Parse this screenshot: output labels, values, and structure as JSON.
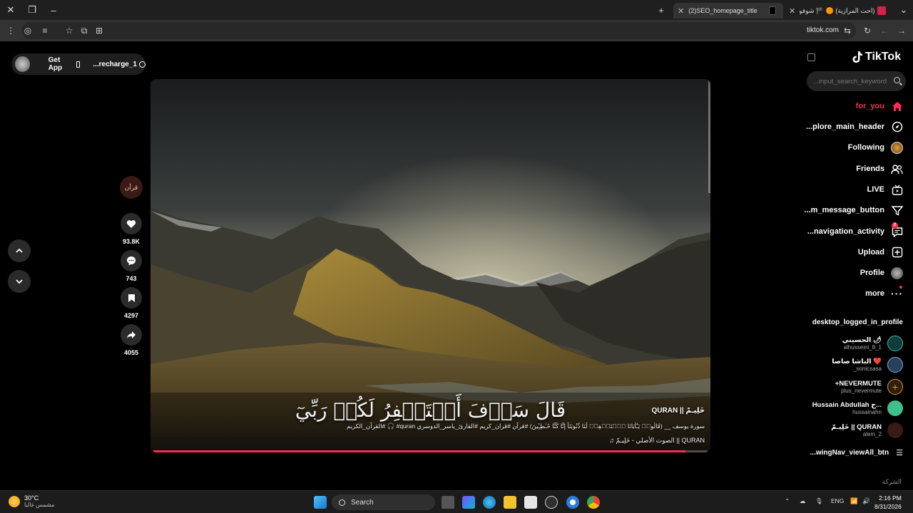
{
  "browser": {
    "tabs": [
      {
        "title": "(2)SEO_homepage_title",
        "active": true
      },
      {
        "title": "(احت المرازية) 🟠 🏴 شوفو حـ",
        "active": false
      }
    ],
    "url": "tiktok.com"
  },
  "top_pill": {
    "get_app_label": "Get App",
    "recharge_label": "...recharge_1"
  },
  "actions": {
    "creator_label": "قرآن",
    "likes": "93.8K",
    "comments": "743",
    "saves": "4297",
    "shares": "4055"
  },
  "video": {
    "verse": "قَالَ سَوۡفَ أَسۡتَغۡفِرُ لَكُمۡ رَبِّيٓ",
    "author": "خَلِيـمّ || QURAN",
    "description": "سورة يوسف __ (قَالُوا۟ يَـٰٓأَبَانَا ٱسۡتَغۡفِرۡ لَنَا ذُنُوبَنَآ إِنَّا كُنَّا خَـٰطِـِٔينَ) #قرآن #قران_كريم #القارئ_ياسر_الدوسري quran# 🎧 #القرآن_الكريم",
    "sound": "QURAN || الصوت الأصلي - خَلِيـمّ",
    "progress": 0.96
  },
  "sidebar": {
    "logo": "TikTok",
    "search_placeholder": "...input_search_keyword",
    "nav": [
      {
        "label": "for_you",
        "icon": "home-icon",
        "active": true
      },
      {
        "label": "...plore_main_header",
        "icon": "explore-icon",
        "active": false
      },
      {
        "label": "Following",
        "icon": "following-avatar-icon",
        "active": false
      },
      {
        "label": "Friends",
        "icon": "friends-icon",
        "active": false
      },
      {
        "label": "LIVE",
        "icon": "live-icon",
        "active": false
      },
      {
        "label": "...m_message_button",
        "icon": "message-icon",
        "active": false
      },
      {
        "label": "...navigation_activity",
        "icon": "activity-icon",
        "active": false,
        "badge": "2"
      },
      {
        "label": "Upload",
        "icon": "upload-icon",
        "active": false
      },
      {
        "label": "Profile",
        "icon": "profile-avatar-icon",
        "active": false
      },
      {
        "label": "more",
        "icon": "more-icon",
        "active": false
      }
    ],
    "following_header": "desktop_logged_in_profile",
    "accounts": [
      {
        "name": "الحسيني 🌶",
        "handle": "alhusseini_8_1",
        "color": "#0f3d3a"
      },
      {
        "name": "الباشا صاصا ❤️",
        "handle": "_sonicsasa",
        "color": "#2a3f5a"
      },
      {
        "name": "+NEVERMUTE",
        "handle": "plus_nevermute",
        "color": "#2e2010"
      },
      {
        "name": "Hussain Abdullah ح...",
        "handle": "hussainahn",
        "color": "#3fbf8a"
      },
      {
        "name": "خَلِيـمّ || QURAN",
        "handle": "alem_2",
        "color": "#3a1a14"
      }
    ],
    "view_all": "...wingNav_viewAll_btn",
    "company": "الشركة"
  },
  "taskbar": {
    "temperature": "30°C",
    "weather": "مشمس غالبا",
    "search_label": "Search",
    "lang": "ENG",
    "time": "2:16 PM",
    "date": "8/31/2026"
  }
}
